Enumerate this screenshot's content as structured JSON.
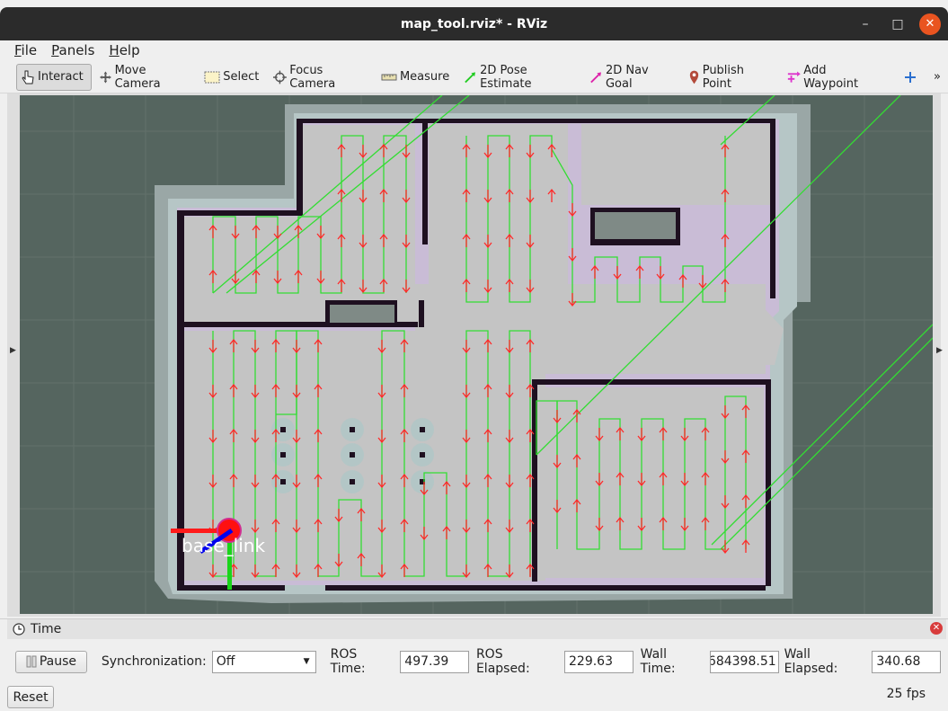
{
  "window": {
    "title": "map_tool.rviz* - RViz",
    "minimize": "–",
    "maximize": "□",
    "close": "✕"
  },
  "menu": [
    {
      "label": "File",
      "mnemonic": "F",
      "rest": "ile"
    },
    {
      "label": "Panels",
      "mnemonic": "P",
      "rest": "anels"
    },
    {
      "label": "Help",
      "mnemonic": "H",
      "rest": "elp"
    }
  ],
  "toolbar": {
    "interact": "Interact",
    "move_camera": "Move Camera",
    "select": "Select",
    "focus_camera": "Focus Camera",
    "measure": "Measure",
    "pose_estimate": "2D Pose Estimate",
    "nav_goal": "2D Nav Goal",
    "publish_point": "Publish Point",
    "add_waypoint": "Add Waypoint",
    "overflow": "»"
  },
  "viewport": {
    "frame_label": "base_link",
    "colors": {
      "background": "#55655f",
      "free": "#c8c8c8",
      "inflation": "#a8d0d0",
      "cost": "#c9b8d6",
      "obstacle": "#1a0f1c",
      "path": "#33dd33",
      "arrow": "#ff2a2a"
    }
  },
  "time_panel": {
    "title": "Time",
    "pause_label": "Pause",
    "sync_label": "Synchronization:",
    "sync_value": "Off",
    "ros_time_label": "ROS Time:",
    "ros_time": "497.39",
    "ros_elapsed_label": "ROS Elapsed:",
    "ros_elapsed": "229.63",
    "wall_time_label": "Wall Time:",
    "wall_time": "684398.51",
    "wall_elapsed_label": "Wall Elapsed:",
    "wall_elapsed": "340.68",
    "reset_label": "Reset",
    "fps": "25 fps"
  }
}
